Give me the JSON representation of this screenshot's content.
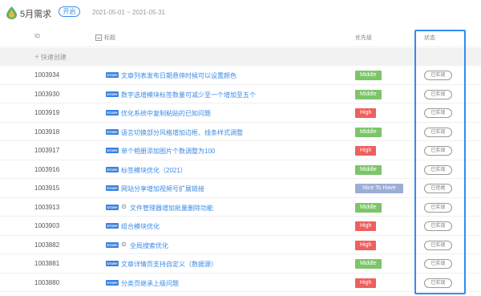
{
  "header": {
    "title": "5月需求",
    "status": "开启",
    "date_range": "2021-05-01 ~ 2021-05-31"
  },
  "columns": {
    "id": "ID",
    "title": "标题",
    "priority": "优先级",
    "state": "状态"
  },
  "quick_create": "快速创建",
  "story_tag": "STORY",
  "colors": {
    "accent": "#3b8ae6",
    "middle": "#7cc56a",
    "high": "#ef5f5f",
    "nice_to_have": "#9aaed6",
    "highlight": "#2f8df0"
  },
  "rows": [
    {
      "id": "1003934",
      "title": "文章列表发布日期悬停时候可以设置颜色",
      "attachment": false,
      "priority": "Middle",
      "state": "已实现"
    },
    {
      "id": "1003930",
      "title": "数字选增模块标签数量可减少至一个增加至五个",
      "attachment": false,
      "priority": "Middle",
      "state": "已实现"
    },
    {
      "id": "1003919",
      "title": "优化系统中复制粘贴的已知问题",
      "attachment": false,
      "priority": "High",
      "state": "已实现"
    },
    {
      "id": "1003918",
      "title": "语言切换部分风格增加边框、线条样式调整",
      "attachment": false,
      "priority": "Middle",
      "state": "已实现"
    },
    {
      "id": "1003917",
      "title": "单个相册添加图片个数调整为100",
      "attachment": false,
      "priority": "High",
      "state": "已实现"
    },
    {
      "id": "1003916",
      "title": "标签模块优化（2021）",
      "attachment": false,
      "priority": "Middle",
      "state": "已实现"
    },
    {
      "id": "1003915",
      "title": "网站分享增加视频号扩展链接",
      "attachment": false,
      "priority": "Nice To Have",
      "state": "已拒绝"
    },
    {
      "id": "1003913",
      "title": "文件管理器增加批量删除功能",
      "attachment": true,
      "priority": "Middle",
      "state": "已实现"
    },
    {
      "id": "1003903",
      "title": "组合模块优化",
      "attachment": false,
      "priority": "High",
      "state": "已实现"
    },
    {
      "id": "1003882",
      "title": "全局搜索优化",
      "attachment": true,
      "priority": "High",
      "state": "已实现"
    },
    {
      "id": "1003881",
      "title": "文章详情页支持自定义（数据源）",
      "attachment": false,
      "priority": "Middle",
      "state": "已实现"
    },
    {
      "id": "1003880",
      "title": "分类页继承上级问题",
      "attachment": false,
      "priority": "High",
      "state": "已实现"
    }
  ]
}
